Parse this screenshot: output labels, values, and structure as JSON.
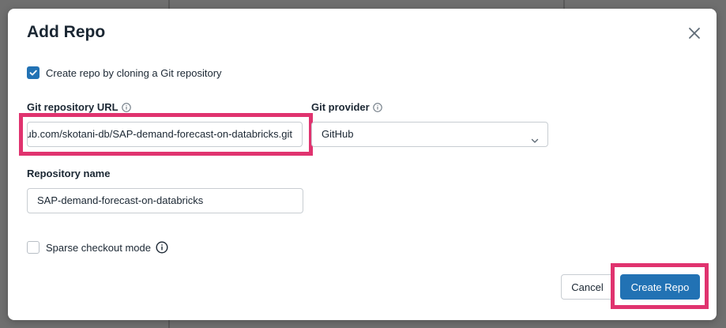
{
  "dialog": {
    "title": "Add Repo",
    "clone_checkbox": {
      "label": "Create repo by cloning a Git repository",
      "checked": true
    },
    "git_url": {
      "label": "Git repository URL",
      "value": "https://github.com/skotani-db/SAP-demand-forecast-on-databricks.git"
    },
    "git_provider": {
      "label": "Git provider",
      "value": "GitHub"
    },
    "repo_name": {
      "label": "Repository name",
      "value": "SAP-demand-forecast-on-databricks"
    },
    "sparse_checkbox": {
      "label": "Sparse checkout mode",
      "checked": false
    },
    "cancel_label": "Cancel",
    "create_label": "Create Repo"
  },
  "colors": {
    "accent": "#2272b4",
    "highlight": "#e0336f"
  }
}
